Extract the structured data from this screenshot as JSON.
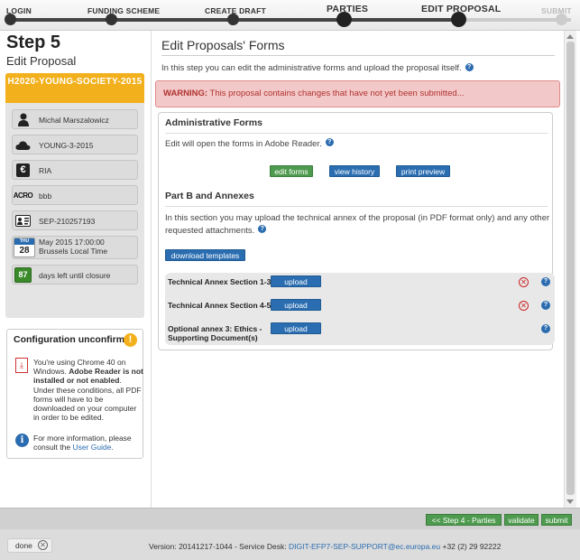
{
  "progress": {
    "steps": [
      {
        "label": "LOGIN"
      },
      {
        "label": "FUNDING SCHEME"
      },
      {
        "label": "CREATE DRAFT"
      },
      {
        "label": "PARTIES"
      },
      {
        "label": "EDIT PROPOSAL"
      },
      {
        "label": "SUBMIT"
      }
    ]
  },
  "step": {
    "title": "Step 5",
    "subtitle": "Edit Proposal"
  },
  "call": {
    "header": "H2020-YOUNG-SOCIETY-2015",
    "coordinator": "Michal Marszalowicz",
    "topic": "YOUNG-3-2015",
    "action_type": "RIA",
    "acronym": "bbb",
    "proposal_id": "SEP-210257193",
    "calendar_month": "THU",
    "calendar_day": "28",
    "deadline": "May 2015 17:00:00 Brussels Local Time",
    "days_left": "87",
    "days_left_text": "days left until closure"
  },
  "config": {
    "title": "Configuration unconfirmed",
    "warn_symbol": "!",
    "text_pre": "You're using Chrome 40 on Windows. ",
    "text_bold": "Adobe Reader is not installed or not enabled",
    "text_post": ". Under these conditions, all PDF forms will have to be downloaded on your computer in order to be edited.",
    "info_pre": "For more information, please consult the ",
    "info_link": "User Guide",
    "info_post": "."
  },
  "main": {
    "title": "Edit Proposals' Forms",
    "intro": "In this step you can edit the administrative forms and upload the proposal itself.",
    "warning_label": "WARNING:",
    "warning_text": "This proposal contains changes that have not yet been submitted...",
    "admin": {
      "title": "Administrative Forms",
      "text": "Edit will open the forms in Adobe Reader.",
      "edit_btn": "edit forms",
      "history_btn": "view history",
      "print_btn": "print preview"
    },
    "partb": {
      "title": "Part B and Annexes",
      "text": "In this section you may upload the technical annex of the proposal (in PDF format only) and any other requested attachments.",
      "download_btn": "download templates",
      "rows": [
        {
          "label": "Technical Annex Section 1-3",
          "button": "upload"
        },
        {
          "label": "Technical Annex Section 4-5",
          "button": "upload"
        },
        {
          "label": "Optional annex 3: Ethics - Supporting Document(s)",
          "button": "upload"
        }
      ]
    }
  },
  "actions": {
    "back": "<< Step 4 - Parties",
    "validate": "validate",
    "submit": "submit"
  },
  "footer": {
    "status": "done",
    "version": "Version: 20141217-1044 - Service Desk: ",
    "email": "DIGIT-EFP7-SEP-SUPPORT@ec.europa.eu",
    "phone": " +32 (2) 29 92222"
  },
  "colors": {
    "accent_green": "#4e9a4e",
    "accent_blue": "#2a6db0",
    "call_orange": "#f2b01c",
    "warning_bg": "#f2c8c8"
  }
}
